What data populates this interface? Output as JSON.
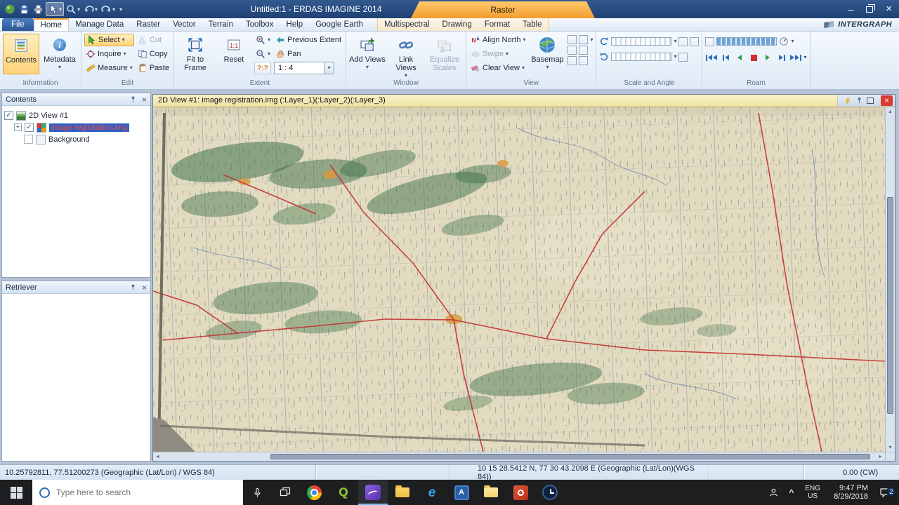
{
  "colors": {
    "titlebar": "#1f4274",
    "accent_orange": "#f49c2d",
    "selection": "#2a5fc4",
    "selected_text": "#ff4b3c",
    "viewer_title": "#efe3a6",
    "status_bg": "#d6e2f0",
    "taskbar_bg": "#1d1e20",
    "map_bg": "#e2dbc0",
    "map_green": "#3f7249",
    "map_red": "#c23030",
    "map_blue": "#4a6fa5"
  },
  "icons": {
    "caret": "▾",
    "close": "×",
    "check": "✓",
    "minimize": "–",
    "scroll_left": "◂",
    "scroll_right": "▸",
    "scroll_up": "▴",
    "scroll_down": "▾",
    "expand": "+",
    "chevron_up": "^"
  },
  "titlebar": {
    "title": "Untitled:1 - ERDAS IMAGINE 2014",
    "context_tab": "Raster"
  },
  "tabs": {
    "file": "File",
    "main": [
      "Home",
      "Manage Data",
      "Raster",
      "Vector",
      "Terrain",
      "Toolbox",
      "Help",
      "Google Earth"
    ],
    "contextual": [
      "Multispectral",
      "Drawing",
      "Format",
      "Table"
    ],
    "brand": "INTERGRAPH"
  },
  "ribbon": {
    "information": {
      "label": "Information",
      "contents": "Contents",
      "metadata": "Metadata"
    },
    "edit": {
      "label": "Edit",
      "select": "Select",
      "inquire": "Inquire",
      "measure": "Measure",
      "cut": "Cut",
      "copy": "Copy",
      "paste": "Paste"
    },
    "extent": {
      "label": "Extent",
      "fit_to_frame": "Fit to Frame",
      "reset": "Reset",
      "previous_extent": "Previous Extent",
      "pan": "Pan",
      "pixel_ratio": "?:?",
      "scale_value": "1 : 4"
    },
    "window": {
      "label": "Window",
      "add_views": "Add Views",
      "link_views": "Link Views",
      "equalize_scales": "Equalize Scales"
    },
    "view": {
      "label": "View",
      "align_north": "Align North",
      "swipe": "Swipe",
      "clear_view": "Clear View",
      "basemap": "Basemap"
    },
    "scale_angle": {
      "label": "Scale and Angle"
    },
    "roam": {
      "label": "Roam"
    }
  },
  "contents_panel": {
    "title": "Contents",
    "items": [
      {
        "label": "2D View #1"
      },
      {
        "label": "image registration.img"
      },
      {
        "label": "Background"
      }
    ]
  },
  "retriever_panel": {
    "title": "Retriever"
  },
  "viewer": {
    "title": "2D View #1: image registration.img (:Layer_1)(:Layer_2)(:Layer_3)"
  },
  "statusbar": {
    "cursor_coords": "10.25792811, 77.51200273  (Geographic (Lat/Lon) / WGS 84)",
    "view_coords": "10 15 28.5412 N,  77 30 43.2098 E (Geographic (Lat/Lon)(WGS 84))",
    "rotation": "0.00 (CW)"
  },
  "taskbar": {
    "search_placeholder": "Type here to search",
    "lang_line1": "ENG",
    "lang_line2": "US",
    "time": "9:47 PM",
    "date": "8/29/2018",
    "notification_count": "2"
  }
}
